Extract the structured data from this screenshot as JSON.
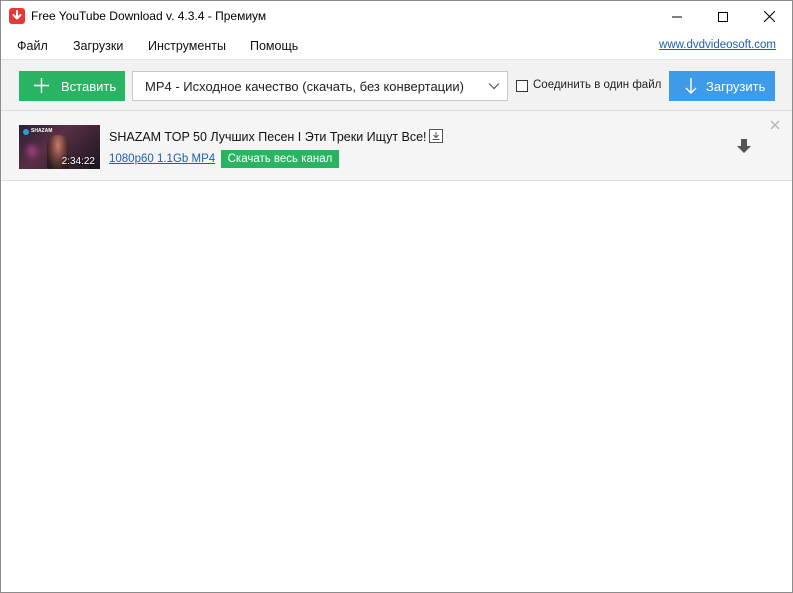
{
  "window": {
    "title": "Free YouTube Download v. 4.3.4 - Премиум",
    "icon": "app-download-icon",
    "brand_color": "#e53935"
  },
  "menu": {
    "items": [
      "Файл",
      "Загрузки",
      "Инструменты",
      "Помощь"
    ],
    "site_link": "www.dvdvideosoft.com"
  },
  "toolbar": {
    "paste_label": "Вставить",
    "format_selected": "MP4 - Исходное качество (скачать, без конвертации)",
    "join_label": "Соединить в один файл",
    "join_checked": false,
    "download_label": "Загрузить",
    "accent_green": "#28b463",
    "accent_blue": "#3d9be9"
  },
  "items": [
    {
      "title": "SHAZAM TOP 50 Лучших Песен I Эти Треки Ищут Все!",
      "duration": "2:34:22",
      "thumb_brand": "SHAZAM",
      "meta": "1080p60 1.1Gb MP4",
      "channel_button": "Скачать весь канал"
    }
  ]
}
